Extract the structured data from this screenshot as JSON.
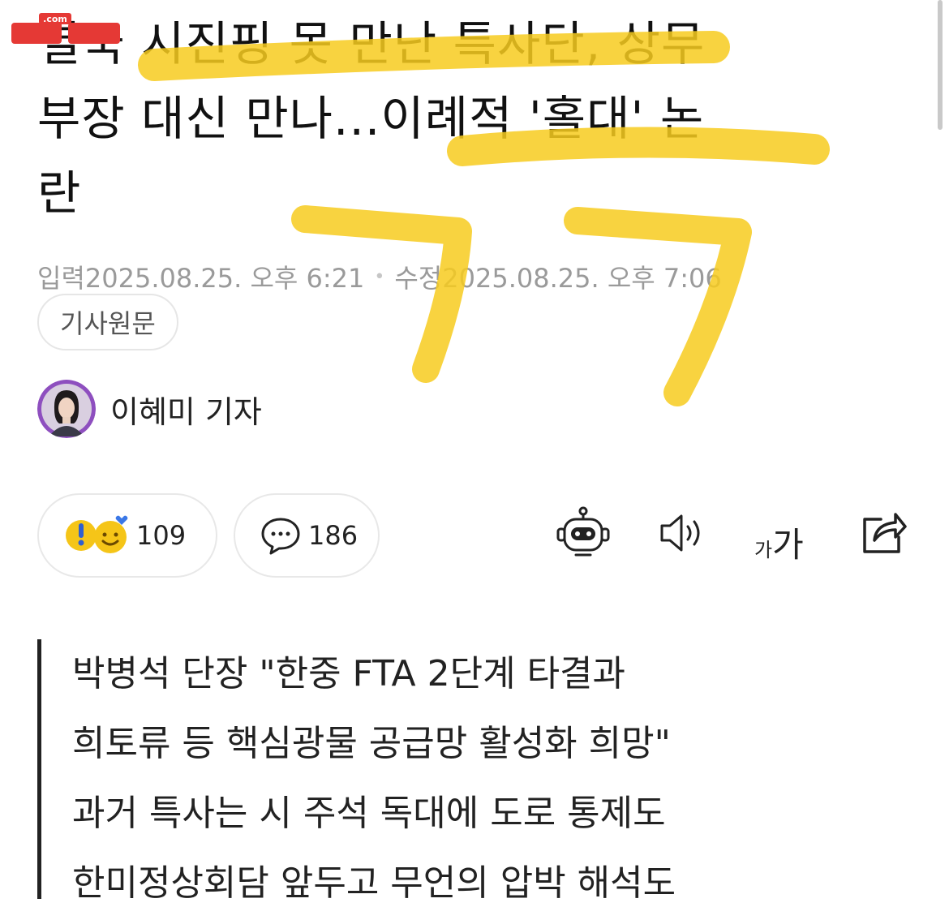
{
  "article": {
    "headline_lines": [
      "결국 시진핑 못 만난 특사단, 상무",
      "부장 대신 만나...이례적 '홀대' 논",
      "란"
    ],
    "meta": {
      "input_label": "입력",
      "input_time": "2025.08.25. 오후 6:21",
      "edit_label": "수정",
      "edit_time": "2025.08.25. 오후 7:06"
    },
    "original_button": "기사원문",
    "author": "이혜미 기자"
  },
  "actions": {
    "reaction_count": "109",
    "comment_count": "186",
    "font_size_small": "가",
    "font_size_big": "가"
  },
  "summary_lines": [
    "박병석 단장 \"한중 FTA 2단계 타결과",
    "희토류 등 핵심광물 공급망 활성화 희망\"",
    "과거 특사는 시 주석 독대에 도로 통제도",
    "한미정상회담 앞두고 무언의 압박 해석도"
  ],
  "watermark_text": ".com",
  "colors": {
    "highlighter": "#F7CB1E",
    "watermark_red": "#E53935",
    "avatar_bg": "#8E4FBF"
  },
  "icons": [
    "alert-emoji-icon",
    "smile-emoji-icon",
    "comment-bubble-icon",
    "robot-summary-icon",
    "speaker-icon",
    "font-size-icon",
    "share-icon"
  ]
}
